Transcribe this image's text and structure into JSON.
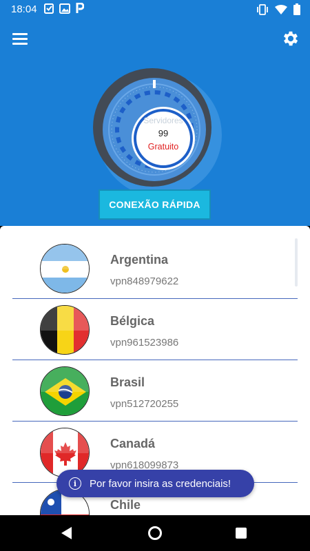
{
  "status": {
    "time": "18:04"
  },
  "header": {
    "menu_icon": "hamburger-menu-icon",
    "settings_icon": "gear-icon"
  },
  "dial": {
    "label": "Servidores",
    "count": "99",
    "plan": "Gratuito"
  },
  "quick_connect": {
    "label": "CONEXÃO RÁPIDA"
  },
  "servers": [
    {
      "country": "Argentina",
      "server": "vpn848979622",
      "flag_icon": "argentina-flag-icon"
    },
    {
      "country": "Bélgica",
      "server": "vpn961523986",
      "flag_icon": "belgium-flag-icon"
    },
    {
      "country": "Brasil",
      "server": "vpn512720255",
      "flag_icon": "brazil-flag-icon"
    },
    {
      "country": "Canadá",
      "server": "vpn618099873",
      "flag_icon": "canada-flag-icon"
    },
    {
      "country": "Chile",
      "server": "",
      "flag_icon": "chile-flag-icon"
    }
  ],
  "toast": {
    "message": "Por favor insira as credenciais!"
  },
  "colors": {
    "primary": "#1a7fd6",
    "button": "#1bb8df",
    "toast": "#3641a8",
    "free_text": "#e02020"
  }
}
